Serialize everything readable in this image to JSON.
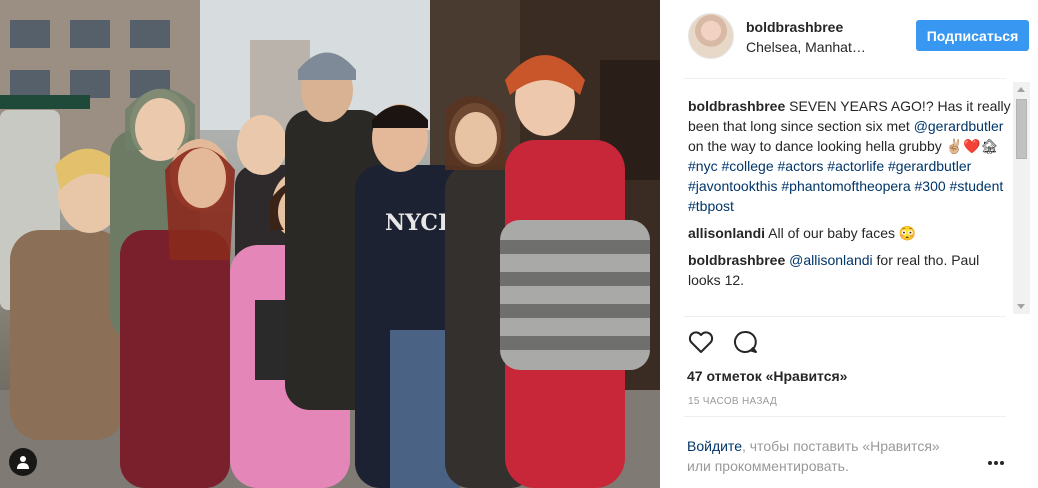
{
  "post": {
    "author": "boldbrashbree",
    "location": "Chelsea, Manhat…",
    "follow_label": "Подписаться"
  },
  "comments": [
    {
      "user": "boldbrashbree",
      "text_1": " SEVEN YEARS AGO!? Has it really been that long since section six met ",
      "mention": "@gerardbutler",
      "text_2": " on the way to dance looking hella grubby ✌🏼❤️🏚 ",
      "hashtags": "#nyc #college #actors #actorlife #gerardbutler #javontookthis #phantomoftheopera #300 #student #tbpost"
    },
    {
      "user": "allisonlandi",
      "text": " All of our baby faces 😳"
    },
    {
      "user": "boldbrashbree",
      "mention": "@allisonlandi",
      "text": " for real tho. Paul looks 12."
    }
  ],
  "stats": {
    "likes": "47 отметок «Нравится»",
    "time": "15 ЧАСОВ НАЗАД"
  },
  "login": {
    "link": "Войдите",
    "rest": ", чтобы поставить «Нравится» или прокомментировать."
  },
  "icons": {
    "like": "heart-icon",
    "comment": "comment-icon",
    "more": "more-options-icon",
    "tag": "user-tag-icon"
  },
  "colors": {
    "accent": "#3897f0",
    "link": "#003569",
    "muted": "#999999"
  }
}
